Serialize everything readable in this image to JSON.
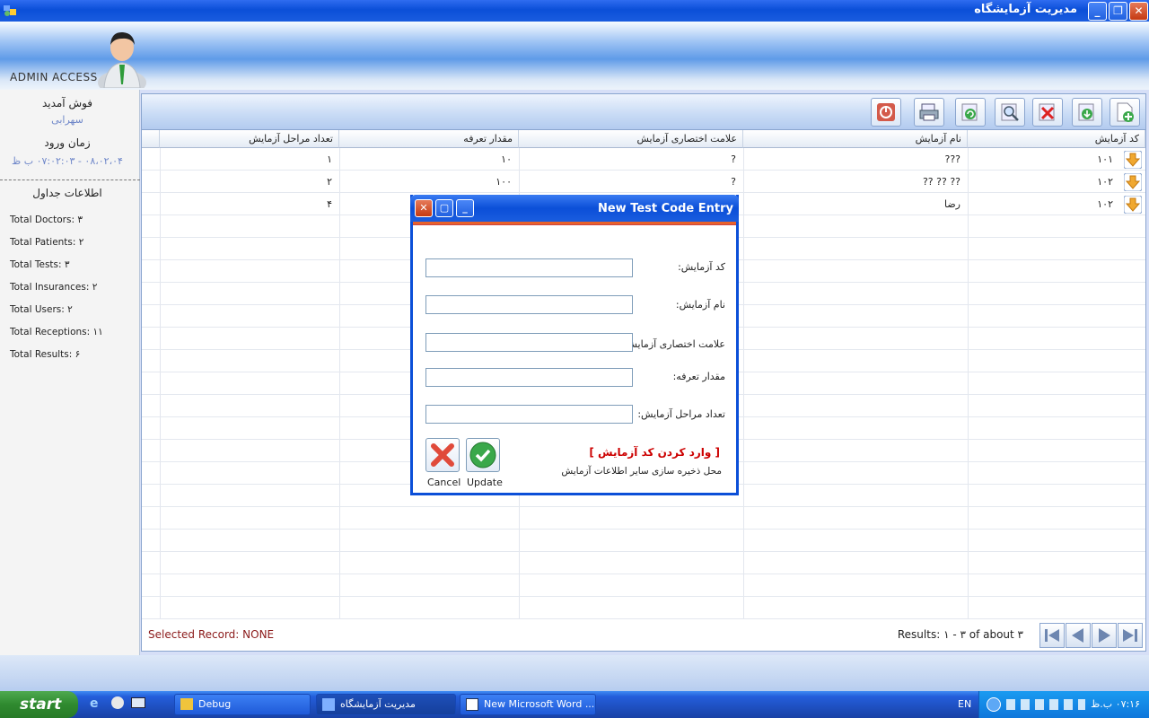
{
  "window": {
    "title": "مدیریت آزمایشگاه"
  },
  "header": {
    "admin_label": "ADMIN ACCESS"
  },
  "sidebar": {
    "user_label": "فوش آمدید",
    "user_name": "سهرابی",
    "login_time_label": "زمان ورود",
    "login_time": "۰۸،۰۲،۰۴ - ۰۷:۰۲:۰۳ ب ظ",
    "info_title": "اطلاعات جداول",
    "stats": [
      "Total Doctors: ۳",
      "Total Patients: ۲",
      "Total Tests: ۳",
      "Total Insurances: ۲",
      "Total Users: ۲",
      "Total Receptions: ۱۱",
      "Total Results: ۶"
    ]
  },
  "grid": {
    "columns": [
      "کد آزمایش",
      "نام آزمایش",
      "علامت اختصاری آزمایش",
      "مقدار تعرفه",
      "تعداد مراحل آزمایش"
    ],
    "rows": [
      {
        "code": "۱۰۱",
        "name": "???",
        "abbr": "?",
        "tariff": "۱۰",
        "steps": "۱"
      },
      {
        "code": "۱۰۲",
        "name": "?? ?? ??",
        "abbr": "?",
        "tariff": "۱۰۰",
        "steps": "۲"
      },
      {
        "code": "۱۰۲",
        "name": "رضا",
        "abbr": "",
        "tariff": "",
        "steps": "۴"
      }
    ],
    "selected_record": "Selected Record: NONE",
    "results": "Results: ۱ - ۳ of about ۳"
  },
  "dialog": {
    "title": "New Test Code Entry",
    "labels": {
      "code": "کد آزمایش:",
      "name": "نام آزمایش:",
      "abbr": "علامت اختصاری آزمایش:",
      "tariff": "مقدار تعرفه:",
      "steps": "تعداد مراحل آزمایش:"
    },
    "header_red": "[ وارد کردن کد آزمایش ]",
    "header_note": "محل ذخیره سازی سایر اطلاعات آزمایش",
    "cancel_label": "Cancel",
    "update_label": "Update"
  },
  "taskbar": {
    "start_label": "start",
    "tasks": [
      "Debug",
      "مدیریت آزمایشگاه",
      "New Microsoft Word ..."
    ],
    "lang": "EN",
    "clock": "۰۷:۱۶ ب.ظ"
  },
  "colors": {
    "titlebar": "#0b4fd8",
    "accent_red": "#c00000",
    "selected_text": "#8b1a1a"
  }
}
